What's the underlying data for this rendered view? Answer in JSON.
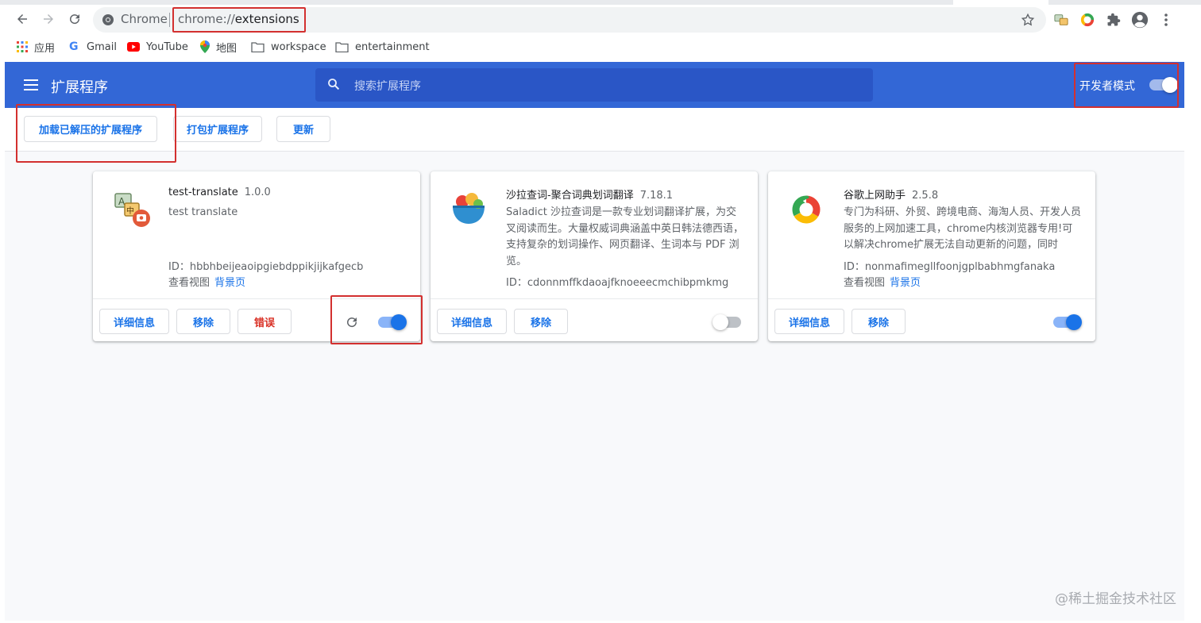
{
  "browser": {
    "site_name": "Chrome",
    "url_scheme": "chrome://",
    "url_path": "extensions",
    "bookmarks": [
      "应用",
      "Gmail",
      "YouTube",
      "地图",
      "workspace",
      "entertainment"
    ]
  },
  "header": {
    "title": "扩展程序",
    "search_placeholder": "搜索扩展程序",
    "dev_mode_label": "开发者模式",
    "dev_mode_on": true
  },
  "actions": {
    "load_unpacked": "加载已解压的扩展程序",
    "pack": "打包扩展程序",
    "update": "更新"
  },
  "extensions": [
    {
      "name": "test-translate",
      "version": "1.0.0",
      "description": "test translate",
      "id": "ID：hbbhbeijeaoipgiebdppikjijkafgecb",
      "views_label": "查看视图",
      "views_link": "背景页",
      "details": "详细信息",
      "remove": "移除",
      "errors": "错误",
      "enabled": true
    },
    {
      "name": "沙拉查词-聚合词典划词翻译",
      "version": "7.18.1",
      "description": "Saladict 沙拉查词是一款专业划词翻译扩展，为交叉阅读而生。大量权威词典涵盖中英日韩法德西语，支持复杂的划词操作、网页翻译、生词本与 PDF 浏览。",
      "id": "ID：cdonnmffkdaoajfknoeeecmchibpmkmg",
      "details": "详细信息",
      "remove": "移除",
      "enabled": false
    },
    {
      "name": "谷歌上网助手",
      "version": "2.5.8",
      "description": "专门为科研、外贸、跨境电商、海淘人员、开发人员服务的上网加速工具，chrome内核浏览器专用!可以解决chrome扩展无法自动更新的问题，同时",
      "id": "ID：nonmafimegllfoonjgplbabhmgfanaka",
      "views_label": "查看视图",
      "views_link": "背景页",
      "details": "详细信息",
      "remove": "移除",
      "enabled": true
    }
  ],
  "watermark": "@稀土掘金技术社区",
  "colors": {
    "header_blue": "#3367d6",
    "link_blue": "#1a73e8",
    "error_red": "#d93025",
    "annotation_red": "#d3302f"
  },
  "icons": [
    "back-icon",
    "forward-icon",
    "reload-icon",
    "star-icon",
    "puzzle-icon",
    "profile-icon",
    "menu-dots-icon",
    "hamburger-icon",
    "search-icon",
    "refresh-icon"
  ]
}
